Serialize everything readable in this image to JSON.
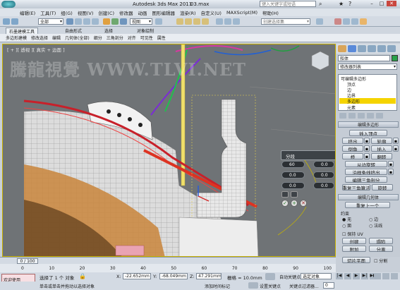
{
  "title_bar": {
    "title": "Autodesk 3ds Max  2011",
    "file": "03.max",
    "search_placeholder": "键入关键字或短语"
  },
  "menu": [
    "编辑(E)",
    "工具(T)",
    "组(G)",
    "视图(V)",
    "创建(C)",
    "修改器",
    "动画",
    "图形编辑器",
    "渲染(R)",
    "自定义(U)",
    "MAXScript(M)",
    "帮助(H)"
  ],
  "toolbar": {
    "filter_value": "全部",
    "view_value": "视图",
    "selection_set_placeholder": "创建选择集"
  },
  "ribbon": {
    "tabs": [
      "石墨建模工具",
      "自由形式",
      "选择",
      "对象绘制"
    ],
    "sub_items": [
      "多边形建模",
      "修改选择",
      "编辑",
      "几何体(全部)",
      "细分",
      "三角剖分",
      "对齐",
      "可见性",
      "属性"
    ]
  },
  "viewport": {
    "label": "[ + ][ 透视 ][ 真实 + 边面 ]",
    "watermark": "騰龍視覺 WWW.TLVI.NET",
    "caddy": {
      "title": "分段",
      "value1": "60",
      "value2": "0.0",
      "value3": "0.0",
      "value4": "0.0",
      "value5": "0.0",
      "value6": "0.0"
    }
  },
  "command_panel": {
    "object_name": "船体",
    "modifier_list": "修改器列表",
    "stack_root": "可编辑多边形",
    "stack_items": [
      "顶点",
      "边",
      "边界",
      "多边形",
      "元素"
    ],
    "stack_selected": "多边形",
    "rollout_edit_poly": "编辑多边形",
    "insert_vertex": "插入顶点",
    "buttons_edit": [
      [
        "挤出",
        "轮廓"
      ],
      [
        "倒角",
        "插入"
      ],
      [
        "桥",
        "翻转"
      ]
    ],
    "from_edge_rotate": "从边旋转",
    "extrude_along_spline": "沿样条线挤出",
    "edit_triangulation": "编辑三角剖分",
    "retriangulate": "重复三角算法",
    "turn": "旋转",
    "rollout_edit_geom": "编辑几何体",
    "repeat_last": "重复上一个",
    "constraints": "约束",
    "constraint_opts": [
      "无",
      "边",
      "面",
      "法线"
    ],
    "preserve_uv": "保持 UV",
    "create": "创建",
    "collapse": "塌陷",
    "attach": "附加",
    "detach": "分离",
    "slice_plane": "切片平面",
    "split": "分割"
  },
  "timeline": {
    "frame": "0 / 100",
    "ticks": [
      "0",
      "10",
      "20",
      "30",
      "40",
      "50",
      "60",
      "70",
      "80",
      "90",
      "100"
    ]
  },
  "status": {
    "welcome": "欢迎使用 MAXSc",
    "selected": "选择了 1 个 对象",
    "x": "-22.652mm",
    "y": "-68.049mm",
    "z": "47.291mm",
    "grid": "栅格 = 10.0mm",
    "auto_key": "自动关键点",
    "set_key": "设置关键点",
    "selected_obj": "选定对象",
    "key_filter": "关键点过滤器...",
    "hint": "单击或单击并拖动以选择对象",
    "add_time_tag": "添加时间标记"
  },
  "colors": {
    "accent": "#f5c400",
    "viewport_bg": "#6f7376",
    "panel_bg": "#c5ccd5"
  }
}
